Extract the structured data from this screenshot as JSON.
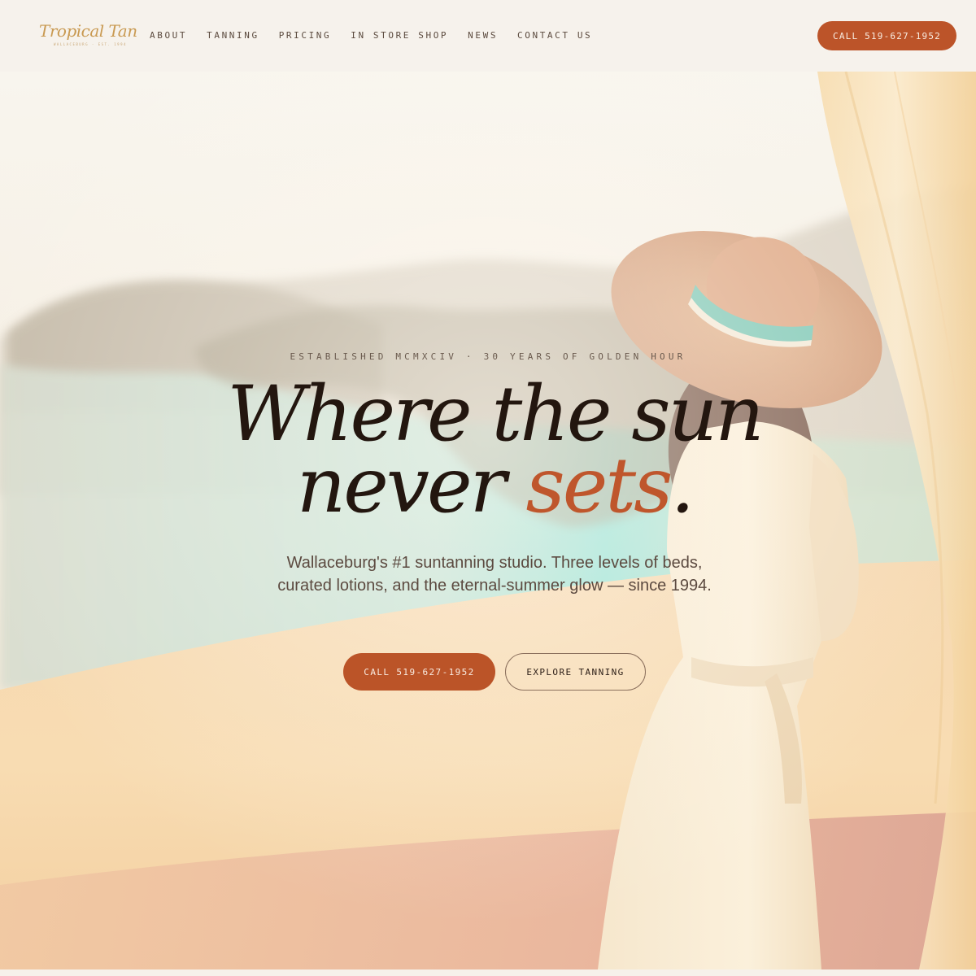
{
  "brand": {
    "name": "Tropical Tan",
    "tagline": "WALLACEBURG · EST. 1994"
  },
  "nav": {
    "items": [
      {
        "label": "ABOUT"
      },
      {
        "label": "TANNING"
      },
      {
        "label": "PRICING"
      },
      {
        "label": "IN STORE SHOP"
      },
      {
        "label": "NEWS"
      },
      {
        "label": "CONTACT US"
      }
    ],
    "cta_label": "CALL 519-627-1952"
  },
  "hero": {
    "eyebrow": "ESTABLISHED MCMXCIV · 30 YEARS OF GOLDEN HOUR",
    "headline_line1": "Where the sun",
    "headline_line2_start": "never ",
    "headline_accent": "sets",
    "headline_period": ".",
    "lede": "Wallaceburg's #1 suntanning studio. Three levels of beds, curated lotions, and the eternal-summer glow — since 1994.",
    "primary_cta": "CALL 519-627-1952",
    "secondary_cta": "EXPLORE TANNING"
  },
  "colors": {
    "accent": "#bc5429",
    "header_bg": "#f6f2ec",
    "ink": "#23160f",
    "logo_gold": "#c99a52"
  }
}
